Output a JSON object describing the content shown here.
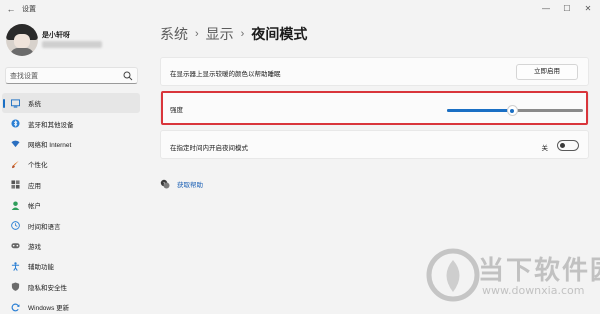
{
  "window": {
    "title": "设置",
    "back_icon": "back-arrow-icon",
    "controls": [
      "minimize",
      "maximize",
      "close"
    ]
  },
  "profile": {
    "name": "是小轩呀"
  },
  "search": {
    "placeholder": "查找设置",
    "icon": "search-icon"
  },
  "sidebar": {
    "items": [
      {
        "label": "系统",
        "icon": "system-icon",
        "active": true
      },
      {
        "label": "蓝牙和其他设备",
        "icon": "bluetooth-icon",
        "active": false
      },
      {
        "label": "网络和 Internet",
        "icon": "network-icon",
        "active": false
      },
      {
        "label": "个性化",
        "icon": "personalization-icon",
        "active": false
      },
      {
        "label": "应用",
        "icon": "apps-icon",
        "active": false
      },
      {
        "label": "帐户",
        "icon": "account-icon",
        "active": false
      },
      {
        "label": "时间和语言",
        "icon": "time-language-icon",
        "active": false
      },
      {
        "label": "游戏",
        "icon": "gaming-icon",
        "active": false
      },
      {
        "label": "辅助功能",
        "icon": "accessibility-icon",
        "active": false
      },
      {
        "label": "隐私和安全性",
        "icon": "privacy-icon",
        "active": false
      },
      {
        "label": "Windows 更新",
        "icon": "windows-update-icon",
        "active": false
      }
    ]
  },
  "breadcrumb": {
    "items": [
      "系统",
      "显示"
    ],
    "separator": "›",
    "current": "夜间模式"
  },
  "settings": {
    "night_light": {
      "label": "在显示器上显示较暖的颜色以帮助睡眠",
      "button": "立即启用"
    },
    "strength": {
      "label": "强度",
      "value_fraction": 0.48,
      "highlighted": true
    },
    "schedule": {
      "label": "在指定时间内开启夜间模式",
      "state_label": "关",
      "on": false
    }
  },
  "help": {
    "label": "获取帮助",
    "icon": "help-icon"
  },
  "watermark": {
    "name": "当下软件园",
    "url": "www.downxia.com"
  },
  "colors": {
    "accent": "#1a6fc4",
    "highlight_border": "#d9353b",
    "background": "#f3f3f3",
    "card": "#fbfbfb"
  }
}
